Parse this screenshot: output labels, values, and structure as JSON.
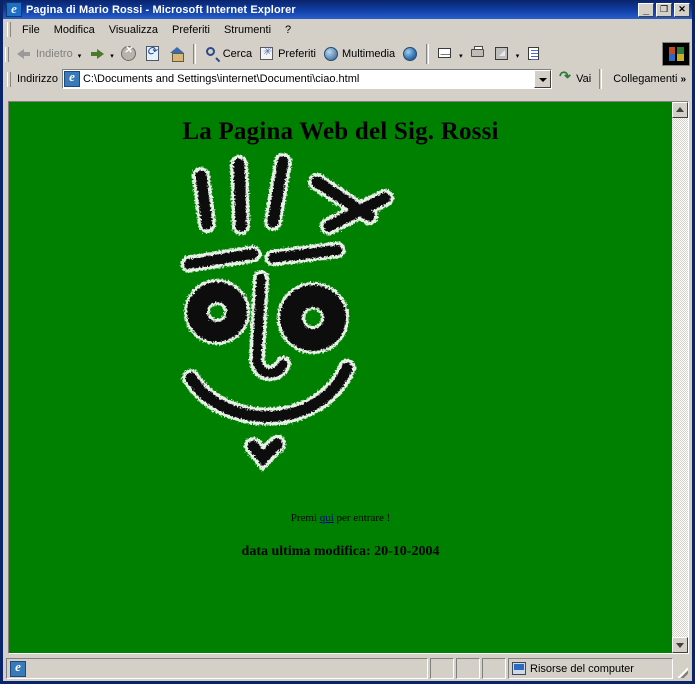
{
  "window": {
    "title": "Pagina di Mario Rossi - Microsoft Internet Explorer",
    "app_icon": "internet-explorer-icon",
    "controls": {
      "minimize": "_",
      "maximize": "❐",
      "close": "✕"
    }
  },
  "menu": {
    "items": [
      {
        "label": "File"
      },
      {
        "label": "Modifica"
      },
      {
        "label": "Visualizza"
      },
      {
        "label": "Preferiti"
      },
      {
        "label": "Strumenti"
      },
      {
        "label": "?"
      }
    ]
  },
  "toolbar": {
    "back": {
      "label": "Indietro",
      "icon": "arrow-left-icon",
      "disabled": true
    },
    "forward": {
      "label": "",
      "icon": "arrow-right-icon"
    },
    "stop": {
      "label": "",
      "icon": "stop-icon"
    },
    "refresh": {
      "label": "",
      "icon": "refresh-icon"
    },
    "home": {
      "label": "",
      "icon": "home-icon"
    },
    "search": {
      "label": "Cerca",
      "icon": "search-icon"
    },
    "favorites": {
      "label": "Preferiti",
      "icon": "favorites-star-icon"
    },
    "media": {
      "label": "Multimedia",
      "icon": "media-globe-icon"
    },
    "history": {
      "label": "",
      "icon": "history-globe-icon"
    },
    "mail": {
      "label": "",
      "icon": "mail-icon"
    },
    "print": {
      "label": "",
      "icon": "printer-icon"
    },
    "edit": {
      "label": "",
      "icon": "edit-page-icon"
    },
    "discuss": {
      "label": "",
      "icon": "discussions-icon"
    },
    "caret": "▾",
    "brand_logo": "windows-flag-logo"
  },
  "address_bar": {
    "label": "Indirizzo",
    "doc_icon": "page-icon",
    "value": "C:\\Documents and Settings\\internet\\Documenti\\ciao.html",
    "placeholder": "",
    "dropdown_icon": "chevron-down-icon",
    "go_label": "Vai",
    "go_icon": "go-arrow-icon",
    "links_label": "Collegamenti",
    "links_chevron": "»"
  },
  "page": {
    "background_color": "#008000",
    "heading": "La Pagina Web del Sig. Rossi",
    "enter_prefix": "Premi ",
    "enter_link": "qui",
    "enter_suffix": " per entrare !",
    "modified_text": "data ultima modifica: 20-10-2004",
    "artwork": {
      "name": "hand-drawn-face",
      "description": "Faccia disegnata a mano: capelli, sopracciglia, occhi, naso, bocca sorridente e mento",
      "stroke_color": "#101010",
      "halo_color": "#e8f4e8"
    }
  },
  "scrollbar": {
    "up_icon": "scroll-up-arrow-icon",
    "down_icon": "scroll-down-arrow-icon"
  },
  "status_bar": {
    "message": "",
    "zone_label": "Risorse del computer",
    "zone_icon": "my-computer-icon",
    "page_icon": "page-icon"
  }
}
